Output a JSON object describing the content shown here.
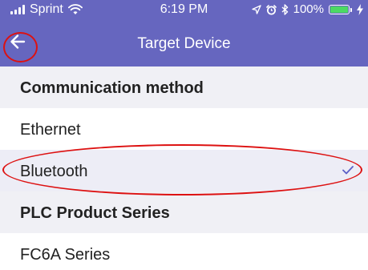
{
  "status_bar": {
    "carrier": "Sprint",
    "time": "6:19 PM",
    "battery": "100%",
    "battery_level": 1.0
  },
  "nav": {
    "title": "Target Device",
    "back_icon": "arrow-left-icon"
  },
  "sections": [
    {
      "header": "Communication method",
      "items": [
        {
          "label": "Ethernet",
          "selected": false
        },
        {
          "label": "Bluetooth",
          "selected": true
        }
      ]
    },
    {
      "header": "PLC Product Series",
      "items": [
        {
          "label": "FC6A Series",
          "selected": false
        }
      ]
    }
  ],
  "colors": {
    "header_bg": "#6666bf",
    "section_bg": "#f0f0f5",
    "selected_row_bg": "#ededf6",
    "checkmark": "#5b5fc7",
    "annotation": "#dd1111",
    "battery_fill": "#4cd964"
  }
}
